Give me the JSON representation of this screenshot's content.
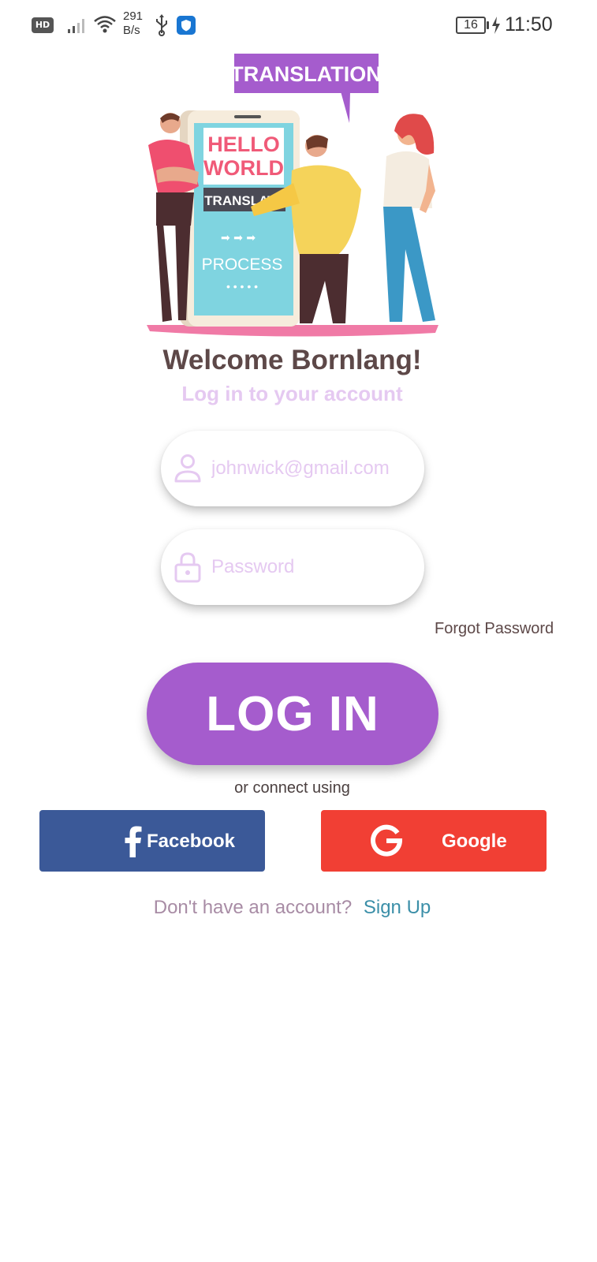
{
  "status_bar": {
    "hd_label": "HD",
    "net_speed_value": "291",
    "net_speed_unit": "B/s",
    "battery_level": "16",
    "time": "11:50"
  },
  "illustration": {
    "banner_text": "TRANSLATION",
    "phone_line1": "HELLO",
    "phone_line2": "WORLD",
    "phone_button": "TRANSLATE",
    "phone_process": "PROCESS"
  },
  "login": {
    "title": "Welcome Bornlang!",
    "subtitle": "Log in to your account",
    "email_placeholder": "johnwick@gmail.com",
    "password_placeholder": "Password",
    "forgot_label": "Forgot Password",
    "login_label": "LOG IN",
    "connect_label": "or connect using",
    "facebook_label": "Facebook",
    "google_label": "Google",
    "no_account_label": "Don't have an account?",
    "signup_label": "Sign Up"
  },
  "colors": {
    "accent": "#a55ccd",
    "title": "#5d4848",
    "subtitle": "#e5c9f1",
    "facebook": "#3b5998",
    "google": "#f13f34",
    "link": "#3b8fa8"
  },
  "icons": {
    "email": "user-icon",
    "password": "lock-icon",
    "facebook": "facebook-f-icon",
    "google": "google-g-icon"
  }
}
